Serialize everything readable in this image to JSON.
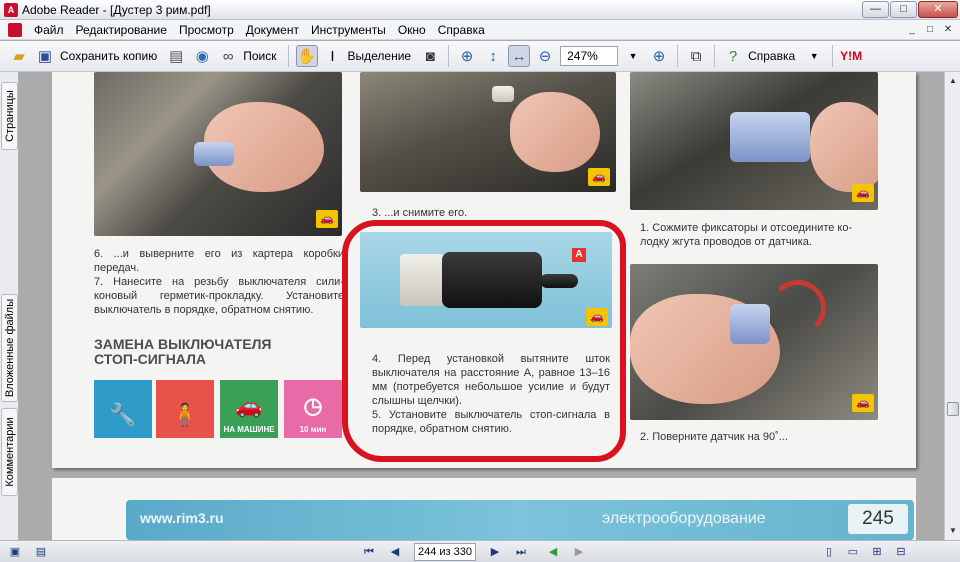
{
  "window": {
    "title": "Adobe Reader - [Дустер 3 рим.pdf]",
    "buttons": {
      "minimize": "—",
      "maximize": "□",
      "close": "✕"
    }
  },
  "menu": {
    "items": [
      "Файл",
      "Редактирование",
      "Просмотр",
      "Документ",
      "Инструменты",
      "Окно",
      "Справка"
    ],
    "doc_controls": [
      "_",
      "□",
      "✕"
    ]
  },
  "toolbar": {
    "save_copy_label": "Сохранить копию",
    "search_label": "Поиск",
    "select_label": "Выделение",
    "zoom_value": "247%",
    "help_label": "Справка",
    "yim_label": "Y!M"
  },
  "leftnav": {
    "tabs": [
      "Страницы",
      "Вложенные файлы",
      "Комментарии"
    ]
  },
  "document": {
    "page": {
      "caption_6": "6. ...и выверните его из картера коробки передач.",
      "caption_7": "7. Нанесите на резьбу выключателя сили-коновый герметик-прокладку. Установите выключатель в порядке, обратном снятию.",
      "caption_3": [
        "3. ...и снимите его."
      ],
      "caption_1": [
        "1. Сожмите фиксаторы и отсоедините ко-",
        "лодку жгута проводов от датчика."
      ],
      "section_title": [
        "ЗАМЕНА ВЫКЛЮЧАТЕЛЯ",
        "СТОП-СИГНАЛА"
      ],
      "caption_4": "4. Перед установкой вытяните шток выключателя на расстояние А, равное 13–16 мм (потребуется небольшое усилие и будут слышны щелчки).",
      "caption_5": "5. Установите выключатель стоп-сигнала в порядке, обратном снятию.",
      "caption_2": [
        "2. Поверните датчик на 90˚..."
      ],
      "label_a": "A",
      "tiles": [
        {
          "icon": "wrench-icon",
          "glyph": "🔧",
          "caption": "",
          "color": "#2f9bc9"
        },
        {
          "icon": "person-icon",
          "glyph": "🧍",
          "caption": "",
          "color": "#e8524a"
        },
        {
          "icon": "car-icon",
          "glyph": "🚗",
          "caption": "НА МАШИНЕ",
          "color": "#3aa057"
        },
        {
          "icon": "timer-icon",
          "glyph": "◷",
          "caption": "10 мин",
          "color": "#e86aa6"
        }
      ]
    },
    "page2": {
      "url": "www.rim3.ru",
      "section": "электрооборудование",
      "page_number": "245"
    }
  },
  "statusbar": {
    "page_indicator": "244 из 330"
  },
  "colors": {
    "highlight_outline": "#d9121f",
    "footer_band": "#66b3cd"
  }
}
